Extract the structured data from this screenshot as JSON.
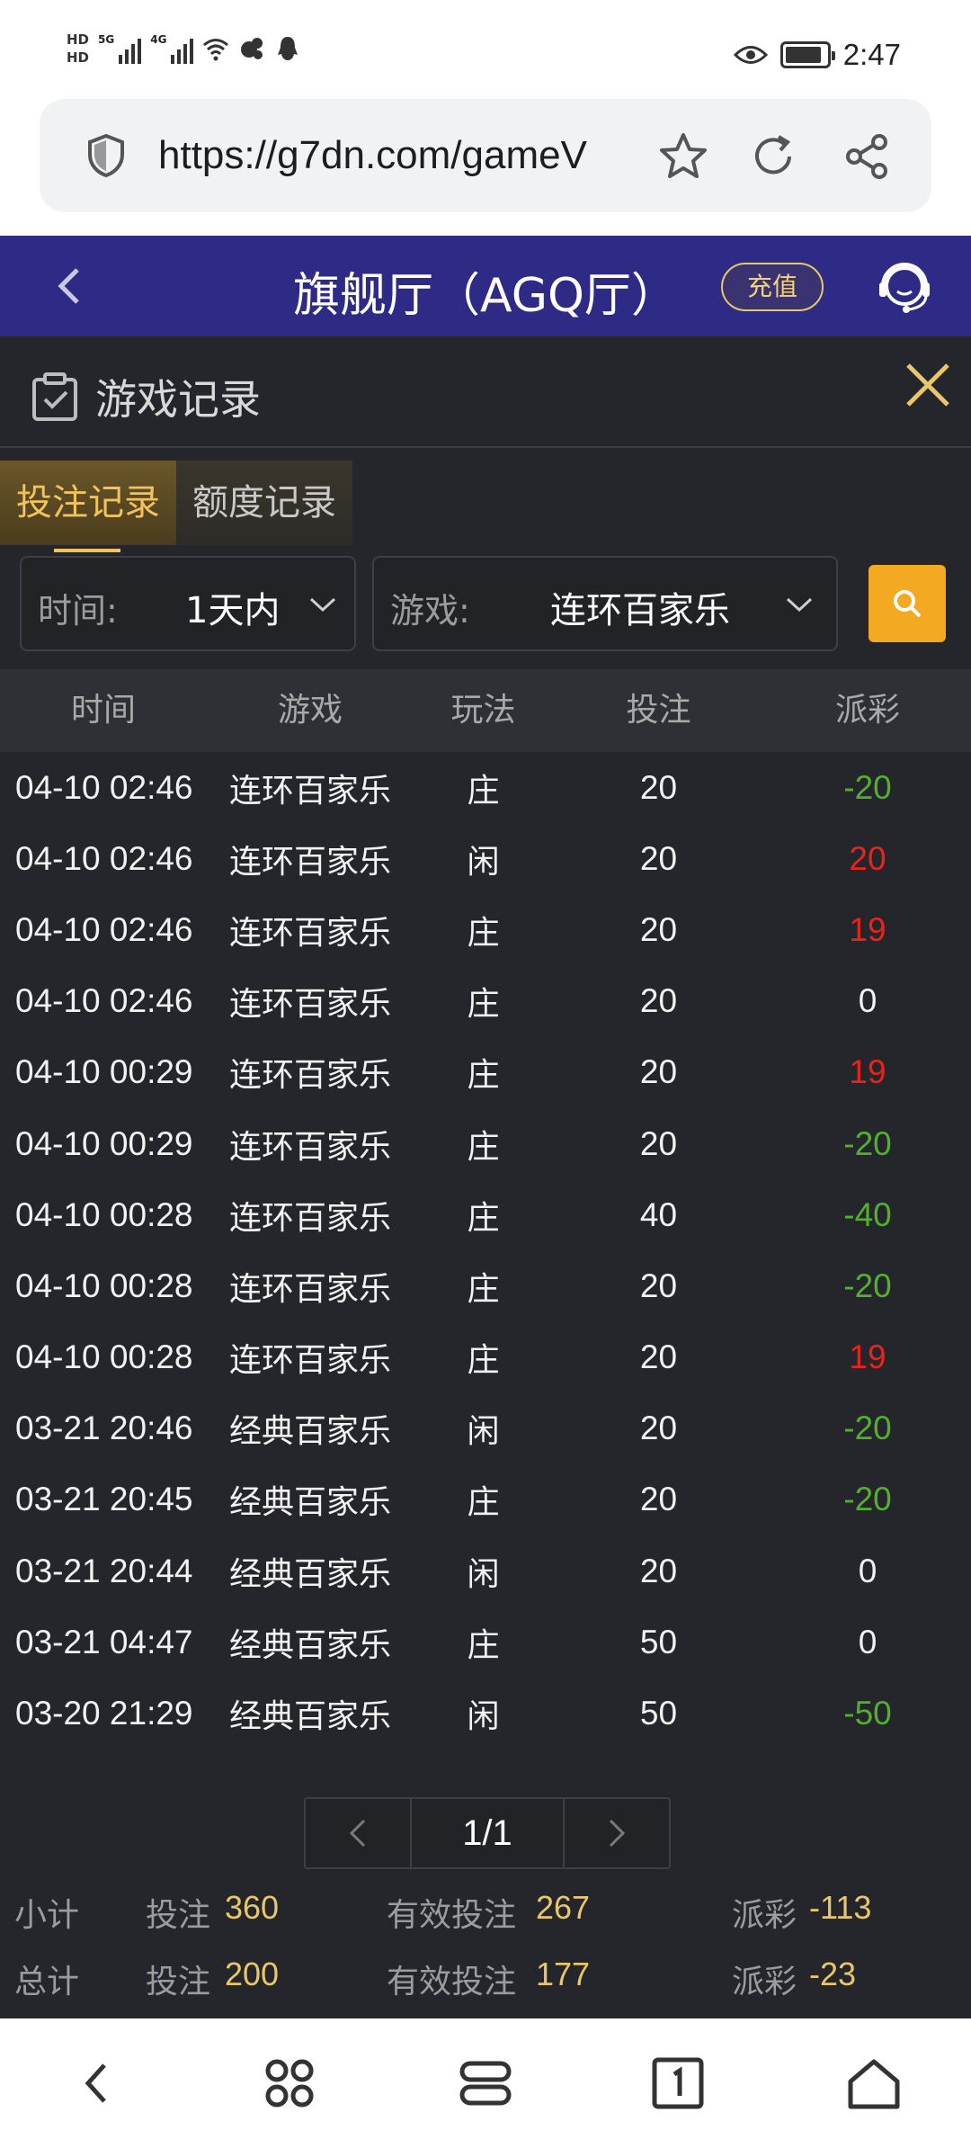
{
  "status_bar": {
    "hd1": "HD",
    "hd2": "HD",
    "sig1": "5G",
    "sig2": "4G",
    "time": "2:47",
    "battery_level": 0.9
  },
  "browser": {
    "url": "https://g7dn.com/gameV"
  },
  "header": {
    "title": "旗舰厅（AGQ厅）",
    "recharge_label": "充值"
  },
  "panel": {
    "title": "游戏记录"
  },
  "tabs": [
    {
      "label": "投注记录",
      "active": true
    },
    {
      "label": "额度记录",
      "active": false
    }
  ],
  "filters": {
    "time_label": "时间:",
    "time_value": "1天内",
    "game_label": "游戏:",
    "game_value": "连环百家乐"
  },
  "table": {
    "headers": [
      "时间",
      "游戏",
      "玩法",
      "投注",
      "派彩"
    ],
    "rows": [
      {
        "time": "04-10 02:46",
        "game": "连环百家乐",
        "play": "庄",
        "bet": "20",
        "payout": "-20",
        "tone": "loss"
      },
      {
        "time": "04-10 02:46",
        "game": "连环百家乐",
        "play": "闲",
        "bet": "20",
        "payout": "20",
        "tone": "win"
      },
      {
        "time": "04-10 02:46",
        "game": "连环百家乐",
        "play": "庄",
        "bet": "20",
        "payout": "19",
        "tone": "win"
      },
      {
        "time": "04-10 02:46",
        "game": "连环百家乐",
        "play": "庄",
        "bet": "20",
        "payout": "0",
        "tone": "neutral"
      },
      {
        "time": "04-10 00:29",
        "game": "连环百家乐",
        "play": "庄",
        "bet": "20",
        "payout": "19",
        "tone": "win"
      },
      {
        "time": "04-10 00:29",
        "game": "连环百家乐",
        "play": "庄",
        "bet": "20",
        "payout": "-20",
        "tone": "loss"
      },
      {
        "time": "04-10 00:28",
        "game": "连环百家乐",
        "play": "庄",
        "bet": "40",
        "payout": "-40",
        "tone": "loss"
      },
      {
        "time": "04-10 00:28",
        "game": "连环百家乐",
        "play": "庄",
        "bet": "20",
        "payout": "-20",
        "tone": "loss"
      },
      {
        "time": "04-10 00:28",
        "game": "连环百家乐",
        "play": "庄",
        "bet": "20",
        "payout": "19",
        "tone": "win"
      },
      {
        "time": "03-21 20:46",
        "game": "经典百家乐",
        "play": "闲",
        "bet": "20",
        "payout": "-20",
        "tone": "loss"
      },
      {
        "time": "03-21 20:45",
        "game": "经典百家乐",
        "play": "庄",
        "bet": "20",
        "payout": "-20",
        "tone": "loss"
      },
      {
        "time": "03-21 20:44",
        "game": "经典百家乐",
        "play": "闲",
        "bet": "20",
        "payout": "0",
        "tone": "neutral"
      },
      {
        "time": "03-21 04:47",
        "game": "经典百家乐",
        "play": "庄",
        "bet": "50",
        "payout": "0",
        "tone": "neutral"
      },
      {
        "time": "03-20 21:29",
        "game": "经典百家乐",
        "play": "闲",
        "bet": "50",
        "payout": "-50",
        "tone": "loss"
      }
    ]
  },
  "pagination": {
    "page": "1/1"
  },
  "summary": {
    "subtotal_label": "小计",
    "total_label": "总计",
    "bet_label": "投注",
    "valid_label": "有效投注",
    "payout_label": "派彩",
    "subtotal": {
      "bet": "360",
      "valid": "267",
      "payout": "-113"
    },
    "total": {
      "bet": "200",
      "valid": "177",
      "payout": "-23"
    }
  },
  "colors": {
    "header_bg": "#2d2b86",
    "accent_gold": "#f2c35b",
    "search_orange": "#f3a922",
    "win_red": "#e8231b",
    "loss_green": "#52b02e",
    "neutral": "#f2f2f2"
  },
  "icons": {
    "status": [
      "wifi-icon",
      "qq-icon",
      "eye-icon",
      "battery-icon"
    ],
    "browser": [
      "shield-icon",
      "star-icon",
      "refresh-icon",
      "share-icon"
    ],
    "header": [
      "back-icon",
      "support-icon"
    ],
    "nav": [
      "nav-back-icon",
      "menu-icon",
      "tabs-icon",
      "tab-count-icon",
      "home-icon"
    ]
  }
}
